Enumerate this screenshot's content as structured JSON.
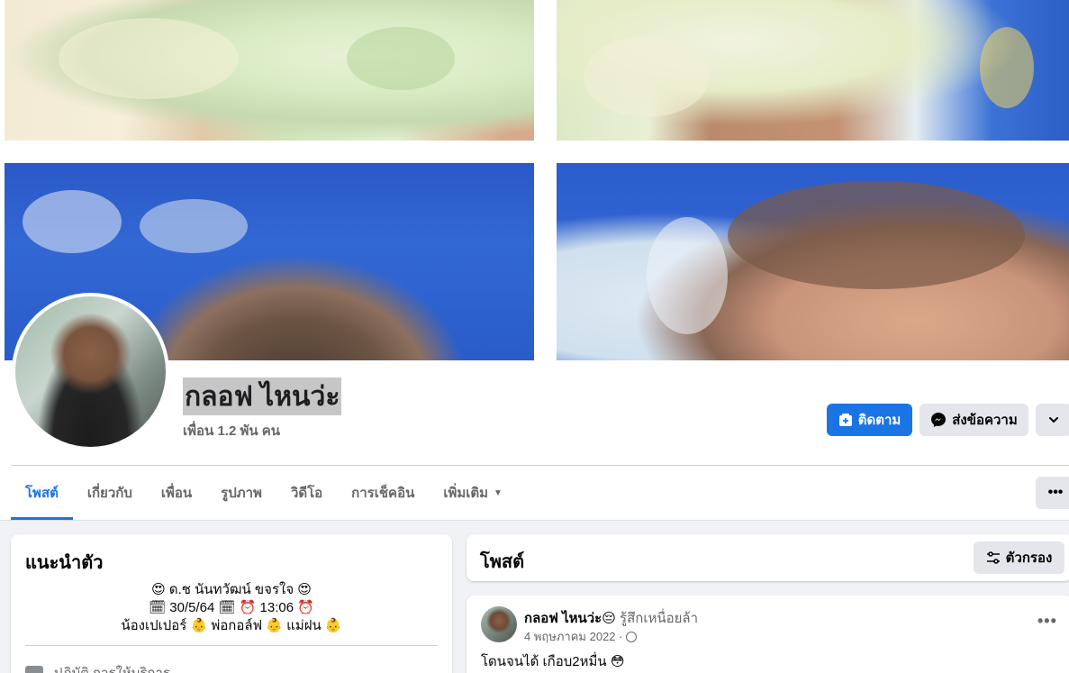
{
  "profile": {
    "name": "กลอฟ ไหนว่ะ",
    "friends": "เพื่อน 1.2 พัน คน"
  },
  "actions": {
    "follow_label": "ติดตาม",
    "message_label": "ส่งข้อความ",
    "more_icon": "chevron-down-icon"
  },
  "tabs": [
    {
      "label": "โพสต์",
      "active": true
    },
    {
      "label": "เกี่ยวกับ"
    },
    {
      "label": "เพื่อน"
    },
    {
      "label": "รูปภาพ"
    },
    {
      "label": "วิดีโอ"
    },
    {
      "label": "การเช็คอิน"
    },
    {
      "label": "เพิ่มเติม"
    }
  ],
  "tabs_more": "•••",
  "intro": {
    "title": "แนะนำตัว",
    "bio_lines": [
      "😍 ด.ช นันทวัฒน์ ขจรใจ 😍",
      "🗓 30/5/64 🗓  ⏰ 13:06 ⏰",
      "น้องเปเปอร์ 👶 พ่อกอล์ฟ 👶 แม่ฝน 👶"
    ],
    "row_text": "ปฏิบัติ การให้บริการ"
  },
  "posts_section": {
    "title": "โพสต์",
    "filter_label": "ตัวกรอง"
  },
  "post": {
    "author": "กลอฟ ไหนว่ะ😔",
    "feeling": " รู้สึกเหนื่อยล้า",
    "date": "4 พฤษภาคม 2022 ·",
    "dots": "•••",
    "text": "โดนจนได้ เกือบ2หมื่น 😳"
  },
  "colors": {
    "accent": "#1b74e4",
    "page_bg": "#f0f2f5",
    "secondary_button": "#e4e6eb"
  }
}
